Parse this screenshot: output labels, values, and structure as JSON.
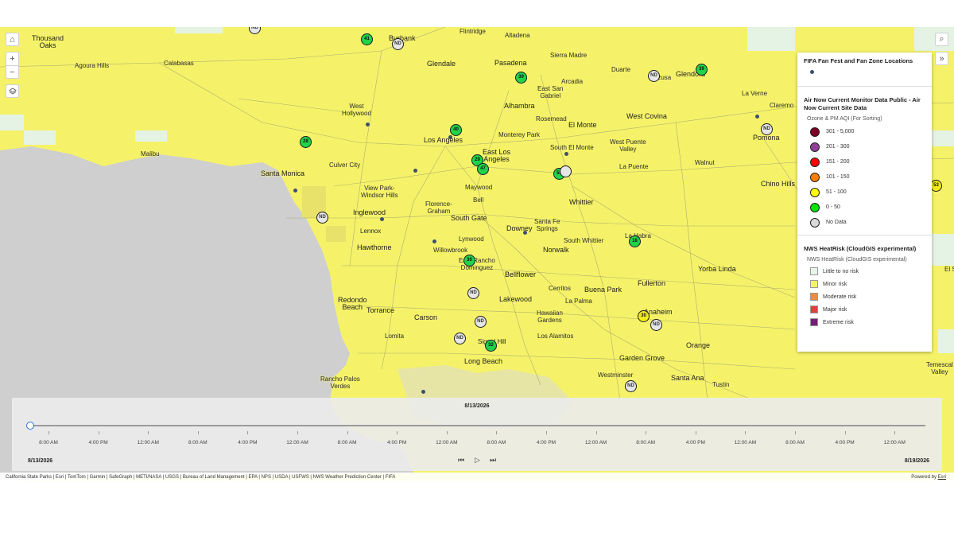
{
  "map": {
    "controls": {
      "home": "⌂",
      "zoom_in": "+",
      "zoom_out": "−",
      "layers": "layers-icon",
      "search": "⌕",
      "expand": "»"
    },
    "places": [
      {
        "name": "Thousand\nOaks",
        "big": true
      },
      {
        "name": "Agoura Hills"
      },
      {
        "name": "Calabasas"
      },
      {
        "name": "Burbank",
        "big": true
      },
      {
        "name": "Flintridge"
      },
      {
        "name": "Altadena"
      },
      {
        "name": "Sierra Madre"
      },
      {
        "name": "Glendale",
        "big": true
      },
      {
        "name": "Pasadena",
        "big": true
      },
      {
        "name": "Duarte"
      },
      {
        "name": "Azusa"
      },
      {
        "name": "Glendora",
        "big": true
      },
      {
        "name": "Arcadia"
      },
      {
        "name": "East San\nGabriel"
      },
      {
        "name": "La Verne"
      },
      {
        "name": "Claremo"
      },
      {
        "name": "Alhambra"
      },
      {
        "name": "West\nHollywood"
      },
      {
        "name": "Rosemead"
      },
      {
        "name": "El Monte",
        "big": true
      },
      {
        "name": "West Covina",
        "big": true
      },
      {
        "name": "Monterey Park"
      },
      {
        "name": "Pomona",
        "big": true
      },
      {
        "name": "Los Angeles",
        "big": true
      },
      {
        "name": "South El Monte"
      },
      {
        "name": "West Puente\nValley"
      },
      {
        "name": "Malibu"
      },
      {
        "name": "East Los\nAngeles",
        "big": true
      },
      {
        "name": "Walnut"
      },
      {
        "name": "Culver City"
      },
      {
        "name": "Santa Monica",
        "big": true
      },
      {
        "name": "La Puente"
      },
      {
        "name": "Chino Hills",
        "big": true
      },
      {
        "name": "View Park-\nWindsor Hills"
      },
      {
        "name": "Maywood"
      },
      {
        "name": "Bell"
      },
      {
        "name": "Whittier",
        "big": true
      },
      {
        "name": "Inglewood",
        "big": true
      },
      {
        "name": "Florence-\nGraham"
      },
      {
        "name": "South Gate",
        "big": true
      },
      {
        "name": "Santa Fe\nSprings"
      },
      {
        "name": "Lennox"
      },
      {
        "name": "Downey",
        "big": true
      },
      {
        "name": "Lynwood"
      },
      {
        "name": "South Whittier"
      },
      {
        "name": "La Habra"
      },
      {
        "name": "Hawthorne",
        "big": true
      },
      {
        "name": "Willowbrook"
      },
      {
        "name": "Norwalk",
        "big": true
      },
      {
        "name": "East Rancho\nDominguez"
      },
      {
        "name": "Yorba Linda",
        "big": true
      },
      {
        "name": "Bellflower",
        "big": true
      },
      {
        "name": "Cerritos"
      },
      {
        "name": "Buena Park",
        "big": true
      },
      {
        "name": "Fullerton",
        "big": true
      },
      {
        "name": "El Se"
      },
      {
        "name": "Redondo\nBeach",
        "big": true
      },
      {
        "name": "Lakewood",
        "big": true
      },
      {
        "name": "La Palma"
      },
      {
        "name": "Torrance",
        "big": true
      },
      {
        "name": "Anaheim",
        "big": true
      },
      {
        "name": "Carson",
        "big": true
      },
      {
        "name": "Hawaiian\nGardens"
      },
      {
        "name": "Lomita"
      },
      {
        "name": "Signal Hill"
      },
      {
        "name": "Los Alamitos"
      },
      {
        "name": "Orange",
        "big": true
      },
      {
        "name": "Long Beach",
        "big": true
      },
      {
        "name": "Garden Grove",
        "big": true
      },
      {
        "name": "Temescal\nValley"
      },
      {
        "name": "Westminster"
      },
      {
        "name": "Santa Ana",
        "big": true
      },
      {
        "name": "Rancho Palos\nVerdes"
      },
      {
        "name": "Tustin"
      }
    ],
    "sensors": [
      {
        "label": "41",
        "c": "g"
      },
      {
        "label": "ND",
        "c": "n"
      },
      {
        "label": "39",
        "c": "g"
      },
      {
        "label": "ND",
        "c": "n"
      },
      {
        "label": "39",
        "c": "g"
      },
      {
        "label": "40",
        "c": "g"
      },
      {
        "label": "28",
        "c": "g"
      },
      {
        "label": "ND",
        "c": "n"
      },
      {
        "label": "29",
        "c": "g"
      },
      {
        "label": "47",
        "c": "g"
      },
      {
        "label": "53",
        "c": "g"
      },
      {
        "label": "",
        "c": "n"
      },
      {
        "label": "ND",
        "c": "n"
      },
      {
        "label": "18",
        "c": "g"
      },
      {
        "label": "30",
        "c": "g"
      },
      {
        "label": "ND",
        "c": "n"
      },
      {
        "label": "ND",
        "c": "n"
      },
      {
        "label": "ND",
        "c": "n"
      },
      {
        "label": "30",
        "c": "y"
      },
      {
        "label": "ND",
        "c": "n"
      },
      {
        "label": "ND",
        "c": "n"
      },
      {
        "label": "32",
        "c": "g"
      },
      {
        "label": "ND",
        "c": "n"
      },
      {
        "label": "53",
        "c": "y"
      }
    ]
  },
  "legend": {
    "fan_title": "FIFA Fan Fest and Fan Zone Locations",
    "aqi_title": "Air Now Current Monitor Data Public - Air Now Current Site Data",
    "aqi_sub": "Ozone & PM AQI (For Sorting)",
    "aqi_items": [
      {
        "label": "301 - 5,000",
        "color": "#7e0023"
      },
      {
        "label": "201 - 300",
        "color": "#8f3f97"
      },
      {
        "label": "151 - 200",
        "color": "#ff0000"
      },
      {
        "label": "101 - 150",
        "color": "#ff7e00"
      },
      {
        "label": "51 - 100",
        "color": "#ffff00"
      },
      {
        "label": "0 - 50",
        "color": "#00e400"
      },
      {
        "label": "No Data",
        "color": "#d9d9d9"
      }
    ],
    "heat_title": "NWS HeatRisk (CloudGIS experimental)",
    "heat_sub": "NWS HeatRisk (CloudGIS experimental)",
    "heat_items": [
      {
        "label": "Little to no risk",
        "color": "#e6f5e6"
      },
      {
        "label": "Minor risk",
        "color": "#f5f26a"
      },
      {
        "label": "Moderate risk",
        "color": "#f08c3a"
      },
      {
        "label": "Major risk",
        "color": "#e0403a"
      },
      {
        "label": "Extreme risk",
        "color": "#7a1a7a"
      }
    ]
  },
  "timeslider": {
    "current": "8/13/2026",
    "start": "8/13/2026",
    "end": "8/19/2026",
    "ticks": [
      "8:00 AM",
      "4:00 PM",
      "12:00 AM",
      "8:00 AM",
      "4:00 PM",
      "12:00 AM",
      "8:00 AM",
      "4:00 PM",
      "12:00 AM",
      "8:00 AM",
      "4:00 PM",
      "12:00 AM",
      "8:00 AM",
      "4:00 PM",
      "12:00 AM",
      "8:00 AM",
      "4:00 PM",
      "12:00 AM"
    ],
    "prev": "⏮",
    "play": "▷",
    "next": "⏭"
  },
  "attribution": {
    "left": "California State Parks | Esri | TomTom | Garmin | SafeGraph | METI/NASA | USGS | Bureau of Land Management | EPA | NPS | USDA | USFWS | NWS Weather Prediction Center | FIFA",
    "right_prefix": "Powered by ",
    "right_link": "Esri"
  }
}
